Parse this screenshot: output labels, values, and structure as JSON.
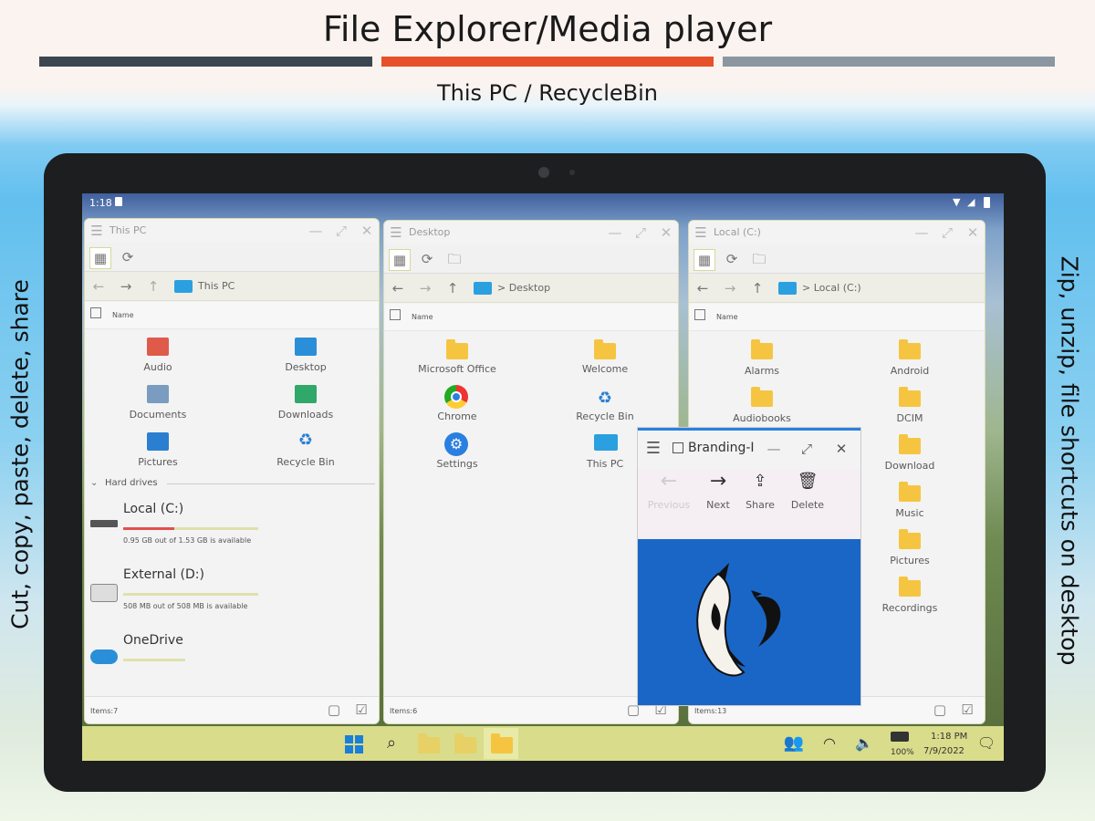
{
  "banner": {
    "title": "File Explorer/Media player",
    "subtitle": "This PC / RecycleBin",
    "left_text": "Cut, copy, paste, delete, share",
    "right_text": "Zip, unzip, file shortcuts on desktop",
    "bar_colors": [
      "#3b4650",
      "#e6502a",
      "#8b96a0"
    ]
  },
  "status": {
    "time": "1:18"
  },
  "win1": {
    "title": "This PC",
    "path": "This PC",
    "col": "Name",
    "items": [
      "Audio",
      "Desktop",
      "Documents",
      "Downloads",
      "Pictures",
      "Recycle Bin"
    ],
    "section": "Hard drives",
    "drives": [
      {
        "name": "Local (C:)",
        "info": "0.95 GB out of 1.53 GB is available",
        "fill": 0.38
      },
      {
        "name": "External (D:)",
        "info": "508 MB out of 508 MB is available",
        "fill": 0.0
      },
      {
        "name": "OneDrive",
        "info": "",
        "fill": 0.0
      }
    ],
    "footer": "Items:7"
  },
  "win2": {
    "title": "Desktop",
    "path": "> Desktop",
    "col": "Name",
    "items": [
      "Microsoft Office",
      "Welcome",
      "Chrome",
      "Recycle Bin",
      "Settings",
      "This PC"
    ],
    "footer": "Items:6"
  },
  "win3": {
    "title": "Local (C:)",
    "path": "> Local (C:)",
    "col": "Name",
    "items": [
      "Alarms",
      "Android",
      "Audiobooks",
      "DCIM",
      "Download",
      "Music",
      "Pictures",
      "Recordings"
    ],
    "footer": "Items:13"
  },
  "viewer": {
    "title": "Branding-I",
    "buttons": [
      "Previous",
      "Next",
      "Share",
      "Delete"
    ],
    "image_bg": "#1a66c6"
  },
  "taskbar": {
    "time": "1:18 PM",
    "date": "7/9/2022",
    "battery": "100%"
  }
}
